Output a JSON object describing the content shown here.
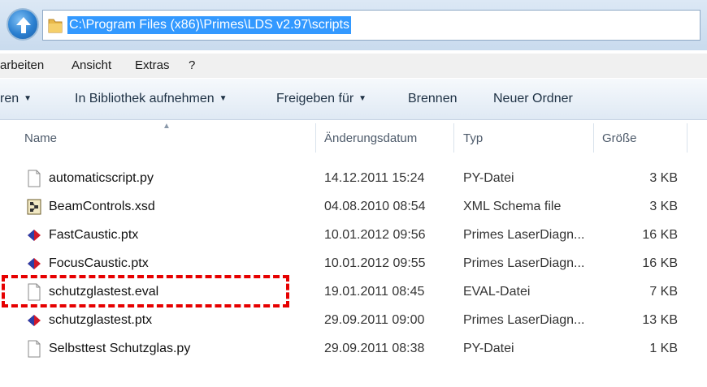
{
  "address": {
    "path": "C:\\Program Files (x86)\\Primes\\LDS v2.97\\scripts"
  },
  "menu": [
    {
      "label": "arbeiten"
    },
    {
      "label": "Ansicht"
    },
    {
      "label": "Extras"
    },
    {
      "label": "?"
    }
  ],
  "toolbar": [
    {
      "label": "ren",
      "has_caret": true
    },
    {
      "label": "In Bibliothek aufnehmen",
      "has_caret": true
    },
    {
      "label": "Freigeben für",
      "has_caret": true
    },
    {
      "label": "Brennen",
      "has_caret": false
    },
    {
      "label": "Neuer Ordner",
      "has_caret": false
    }
  ],
  "columns": {
    "name": "Name",
    "date": "Änderungsdatum",
    "type": "Typ",
    "size": "Größe"
  },
  "files": [
    {
      "icon": "text-file-icon",
      "name": "automaticscript.py",
      "date": "14.12.2011 15:24",
      "type": "PY-Datei",
      "size": "3 KB"
    },
    {
      "icon": "xml-schema-icon",
      "name": "BeamControls.xsd",
      "date": "04.08.2010 08:54",
      "type": "XML Schema file",
      "size": "3 KB"
    },
    {
      "icon": "primes-diamond-icon",
      "name": "FastCaustic.ptx",
      "date": "10.01.2012 09:56",
      "type": "Primes LaserDiagn...",
      "size": "16 KB"
    },
    {
      "icon": "primes-diamond-icon",
      "name": "FocusCaustic.ptx",
      "date": "10.01.2012 09:55",
      "type": "Primes LaserDiagn...",
      "size": "16 KB"
    },
    {
      "icon": "text-file-icon",
      "name": "schutzglastest.eval",
      "date": "19.01.2011 08:45",
      "type": "EVAL-Datei",
      "size": "7 KB"
    },
    {
      "icon": "primes-diamond-icon",
      "name": "schutzglastest.ptx",
      "date": "29.09.2011 09:00",
      "type": "Primes LaserDiagn...",
      "size": "13 KB"
    },
    {
      "icon": "text-file-icon",
      "name": "Selbsttest Schutzglas.py",
      "date": "29.09.2011 08:38",
      "type": "PY-Datei",
      "size": "1 KB"
    }
  ],
  "highlight": {
    "color": "#e60000",
    "row": 4
  },
  "colors": {
    "selection": "#3399ff",
    "toolbar_bg": "#dfe9f4"
  }
}
